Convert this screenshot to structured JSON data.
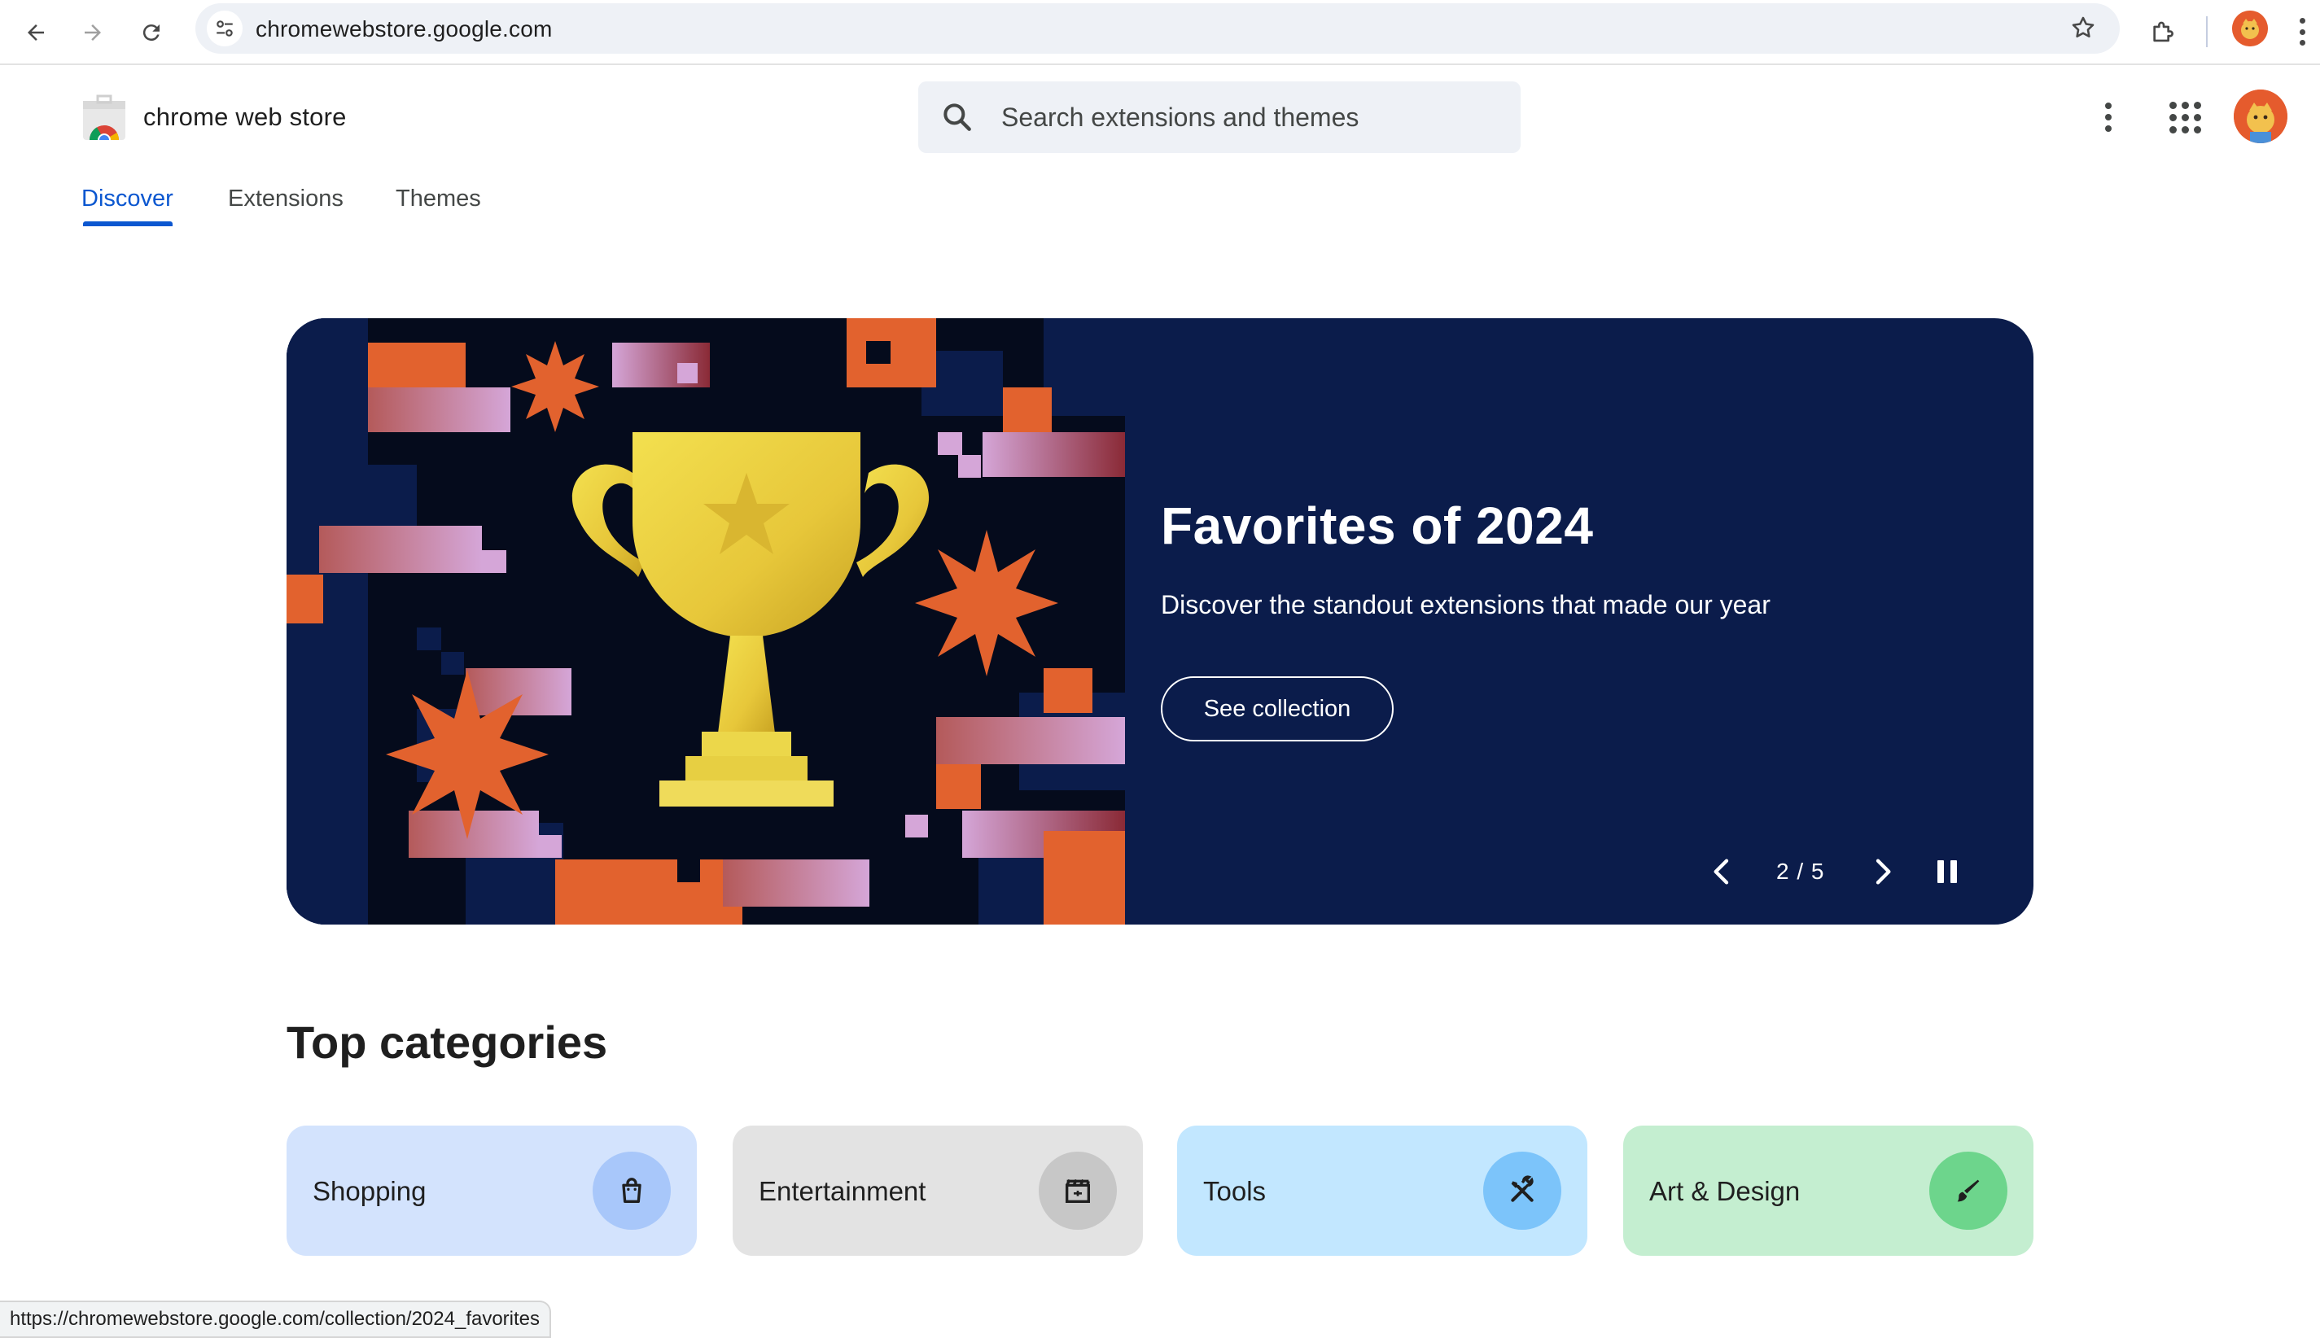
{
  "browser": {
    "url": "chromewebstore.google.com",
    "status_url": "https://chromewebstore.google.com/collection/2024_favorites"
  },
  "header": {
    "store_name": "chrome web store",
    "search_placeholder": "Search extensions and themes"
  },
  "tabs": [
    {
      "label": "Discover",
      "active": true
    },
    {
      "label": "Extensions",
      "active": false
    },
    {
      "label": "Themes",
      "active": false
    }
  ],
  "hero": {
    "title": "Favorites of 2024",
    "subtitle": "Discover the standout extensions that made our year",
    "cta": "See collection",
    "counter": "2 / 5",
    "background_color": "#0b1c4b"
  },
  "top_categories": {
    "title": "Top categories",
    "items": [
      {
        "label": "Shopping",
        "icon": "shopping-bag-icon",
        "card_color": "#d3e3fd",
        "icon_bg": "#a8c7fa"
      },
      {
        "label": "Entertainment",
        "icon": "clapperboard-icon",
        "card_color": "#e3e3e3",
        "icon_bg": "#c7c7c7"
      },
      {
        "label": "Tools",
        "icon": "tools-icon",
        "card_color": "#c2e7ff",
        "icon_bg": "#7cc4fa"
      },
      {
        "label": "Art & Design",
        "icon": "brush-icon",
        "card_color": "#c4eed0",
        "icon_bg": "#6dd58c"
      }
    ]
  },
  "colors": {
    "accent": "#0b57d0",
    "hero_orange": "#e2622e",
    "trophy_gold": "#ecd74a"
  }
}
